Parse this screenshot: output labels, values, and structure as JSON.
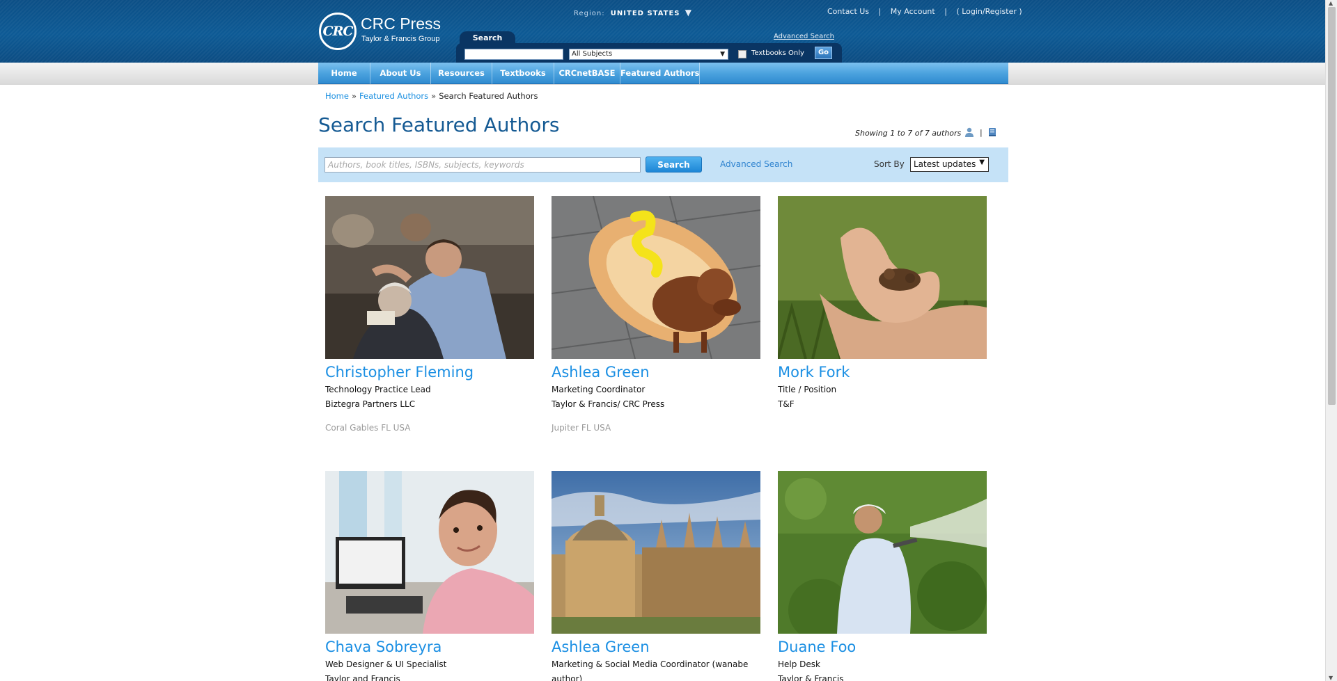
{
  "header": {
    "logo_mark": "CRC",
    "logo_name": "CRC Press",
    "logo_sub": "Taylor & Francis Group",
    "region_label": "Region:",
    "region_value": "UNITED STATES",
    "contact_us": "Contact Us",
    "my_account": "My Account",
    "login_register": "( Login/Register )",
    "search_tab": "Search",
    "advanced_search": "Advanced Search",
    "subject_select": "All Subjects",
    "textbooks_only": "Textbooks Only",
    "go_button": "Go"
  },
  "nav": {
    "items": [
      {
        "label": "Home"
      },
      {
        "label": "About Us"
      },
      {
        "label": "Resources"
      },
      {
        "label": "Textbooks"
      },
      {
        "label": "CRCnetBASE"
      },
      {
        "label": "Featured Authors"
      }
    ]
  },
  "breadcrumb": {
    "home": "Home",
    "featured": "Featured Authors",
    "current": "Search Featured Authors"
  },
  "page": {
    "title": "Search Featured Authors",
    "showing": "Showing 1 to 7 of 7 authors"
  },
  "filter": {
    "placeholder": "Authors, book titles, ISBNs, subjects, keywords",
    "search_button": "Search",
    "advanced_search": "Advanced Search",
    "sort_by_label": "Sort By",
    "sort_value": "Latest updates"
  },
  "authors": [
    {
      "name": "Christopher Fleming",
      "title": "Technology Practice Lead",
      "org": "Biztegra Partners LLC",
      "location": "Coral Gables FL USA"
    },
    {
      "name": "Ashlea Green",
      "title": "Marketing Coordinator",
      "org": "Taylor & Francis/ CRC Press",
      "location": "Jupiter FL USA"
    },
    {
      "name": "Mork Fork",
      "title": "Title / Position",
      "org": "T&F",
      "location": ""
    },
    {
      "name": "Chava Sobreyra",
      "title": "Web Designer & UI Specialist",
      "org": "Taylor and Francis",
      "location": ""
    },
    {
      "name": "Ashlea Green",
      "title": "Marketing & Social Media Coordinator (wanabe",
      "org": "author)",
      "location": ""
    },
    {
      "name": "Duane Foo",
      "title": "Help Desk",
      "org": "Taylor & Francis",
      "location": ""
    }
  ],
  "colors": {
    "header_blue": "#0d5a95",
    "nav_blue": "#4ca3df",
    "link_blue": "#1b8fe3",
    "title_blue": "#155a93",
    "filter_bg": "#c5e2f7"
  }
}
